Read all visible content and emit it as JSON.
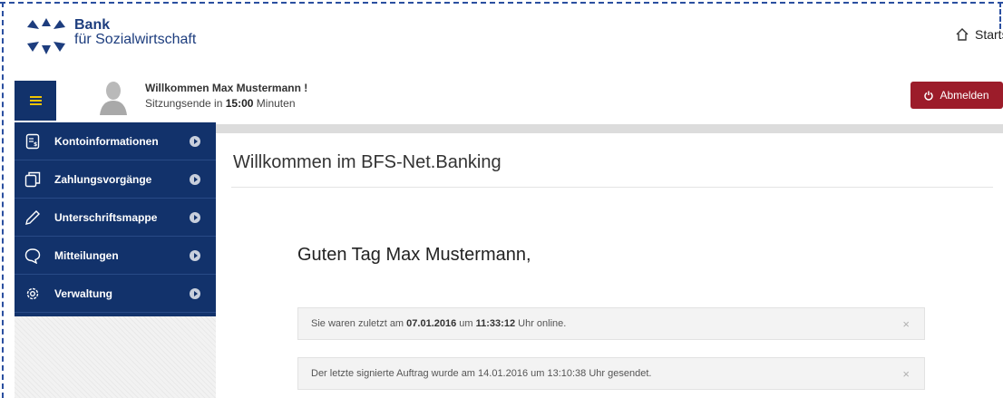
{
  "header": {
    "logo_line1": "Bank",
    "logo_line2": "für Sozialwirtschaft",
    "home_label": "Startseite"
  },
  "session": {
    "welcome": "Willkommen Max Mustermann !",
    "session_prefix": "Sitzungsende in",
    "session_time": "15:00",
    "session_suffix": "Minuten",
    "logout_label": "Abmelden"
  },
  "sidebar": {
    "items": [
      {
        "label": "Kontoinformationen",
        "icon": "account-info-icon"
      },
      {
        "label": "Zahlungsvorgänge",
        "icon": "payments-icon"
      },
      {
        "label": "Unterschriftsmappe",
        "icon": "pen-icon"
      },
      {
        "label": "Mitteilungen",
        "icon": "speech-bubble-icon"
      },
      {
        "label": "Verwaltung",
        "icon": "gear-icon"
      }
    ]
  },
  "main": {
    "title": "Willkommen im BFS-Net.Banking",
    "greeting": "Guten Tag Max Mustermann,",
    "notices": [
      {
        "t1": "Sie waren zuletzt am",
        "date": "07.01.2016",
        "t2": "um",
        "time": "11:33:12",
        "t3": "Uhr online."
      },
      {
        "text": "Der letzte signierte Auftrag wurde am 14.01.2016 um 13:10:38 Uhr gesendet."
      }
    ],
    "close_glyph": "×"
  },
  "colors": {
    "brand_navy": "#12326b",
    "logout_red": "#9c1c2a",
    "menu_yellow": "#f0c400"
  }
}
